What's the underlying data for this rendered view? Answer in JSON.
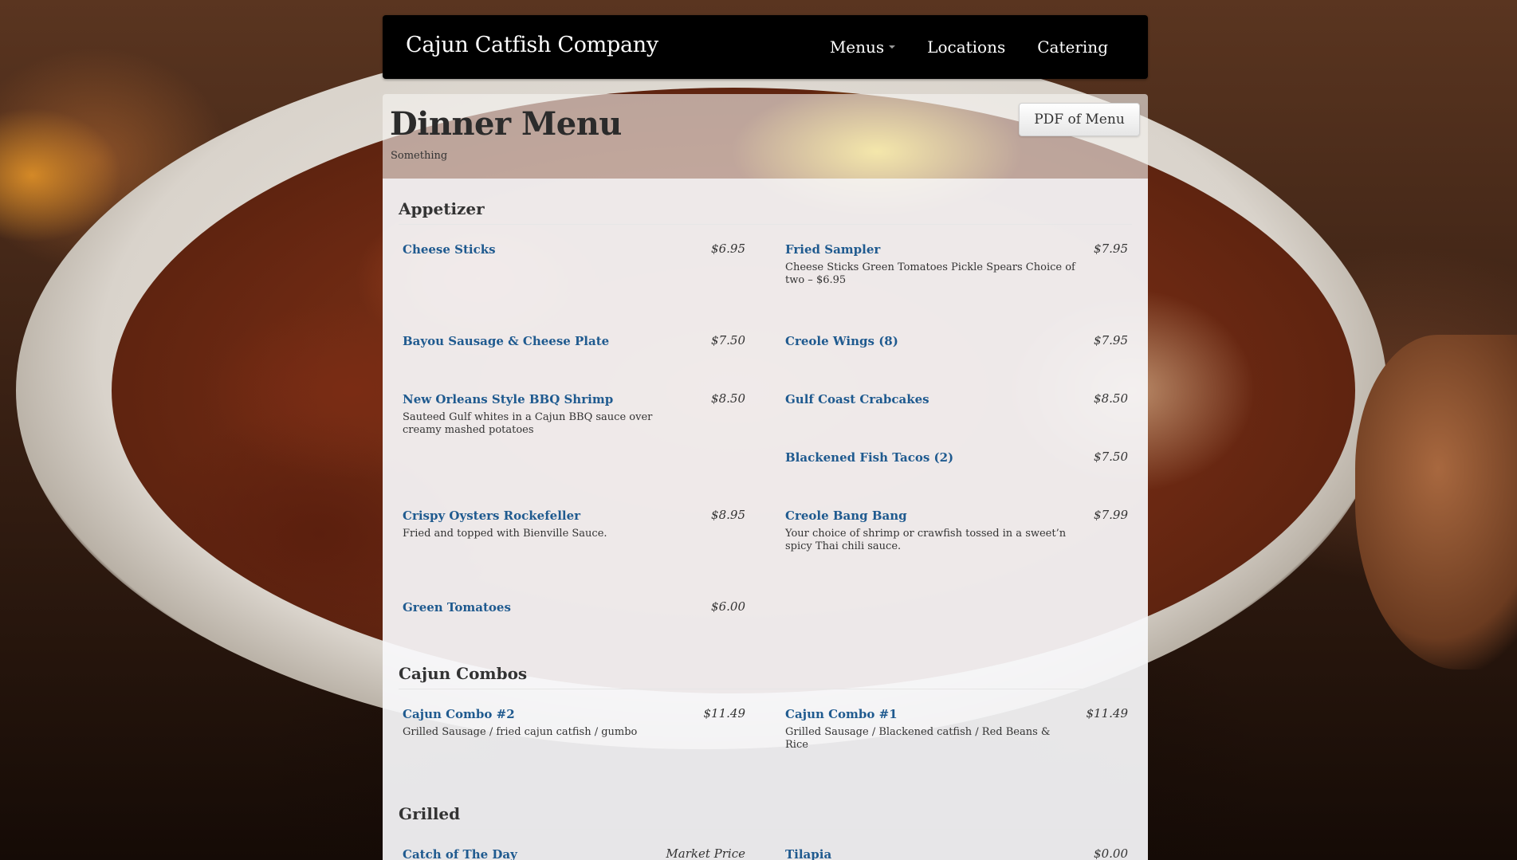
{
  "site": {
    "brand": "Cajun Catfish Company",
    "nav": [
      {
        "label": "Menus",
        "dropdown": true
      },
      {
        "label": "Locations",
        "dropdown": false
      },
      {
        "label": "Catering",
        "dropdown": false
      }
    ]
  },
  "menu": {
    "title": "Dinner Menu",
    "subtitle": "Something",
    "pdf_button": "PDF of Menu"
  },
  "sections": [
    {
      "title": "Appetizer",
      "items": [
        {
          "name": "Cheese Sticks",
          "price": "$6.95",
          "description": ""
        },
        {
          "name": "Fried Sampler",
          "price": "$7.95",
          "description": "Cheese Sticks Green Tomatoes Pickle Spears Choice of two – $6.95"
        },
        {
          "name": "Bayou Sausage & Cheese Plate",
          "price": "$7.50",
          "description": ""
        },
        {
          "name": "Creole Wings (8)",
          "price": "$7.95",
          "description": ""
        },
        {
          "name": "New Orleans Style BBQ Shrimp",
          "price": "$8.50",
          "description": "Sauteed Gulf whites in a Cajun BBQ sauce over creamy mashed potatoes"
        },
        {
          "name": "Gulf Coast Crabcakes",
          "price": "$8.50",
          "description": ""
        },
        {
          "name": "Blackened Fish Tacos (2)",
          "price": "$7.50",
          "description": ""
        },
        {
          "name": "Crispy Oysters Rockefeller",
          "price": "$8.95",
          "description": "Fried and topped with Bienville Sauce."
        },
        {
          "name": "Creole Bang Bang",
          "price": "$7.99",
          "description": "Your choice of shrimp or crawfish tossed in a sweet’n spicy Thai chili sauce."
        },
        {
          "name": "Green Tomatoes",
          "price": "$6.00",
          "description": ""
        }
      ]
    },
    {
      "title": "Cajun Combos",
      "items": [
        {
          "name": "Cajun Combo #2",
          "price": "$11.49",
          "description": "Grilled Sausage / fried cajun catfish / gumbo"
        },
        {
          "name": "Cajun Combo #1",
          "price": "$11.49",
          "description": "Grilled Sausage / Blackened catfish / Red Beans & Rice"
        }
      ]
    },
    {
      "title": "Grilled",
      "items": [
        {
          "name": "Catch of The Day",
          "price": "Market Price",
          "description": ""
        },
        {
          "name": "Tilapia",
          "price": "$0.00",
          "description": ""
        }
      ]
    }
  ],
  "colors": {
    "navbar_bg": "#000000",
    "item_link": "#1f5a8f",
    "panel_bg": "#f8f8fa"
  }
}
